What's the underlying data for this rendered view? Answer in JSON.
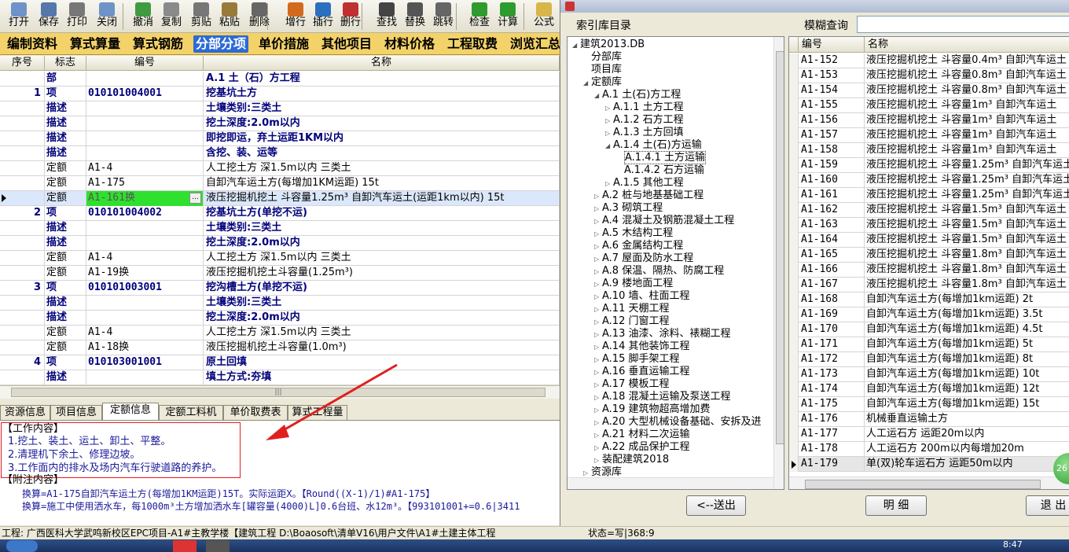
{
  "toolbar": {
    "buttons": [
      {
        "label": "打开",
        "icon": "folder-open-icon"
      },
      {
        "label": "保存",
        "icon": "save-icon"
      },
      {
        "label": "打印",
        "icon": "printer-icon"
      },
      {
        "label": "关闭",
        "icon": "close-folder-icon"
      },
      {
        "label": "撤消",
        "icon": "undo-icon"
      },
      {
        "label": "复制",
        "icon": "copy-icon"
      },
      {
        "label": "剪贴",
        "icon": "scissors-icon"
      },
      {
        "label": "粘贴",
        "icon": "paste-icon"
      },
      {
        "label": "删除",
        "icon": "delete-icon"
      },
      {
        "label": "增行",
        "icon": "add-row-icon"
      },
      {
        "label": "插行",
        "icon": "insert-row-icon"
      },
      {
        "label": "删行",
        "icon": "delete-row-icon"
      },
      {
        "label": "查找",
        "icon": "binoculars-icon"
      },
      {
        "label": "替换",
        "icon": "replace-icon"
      },
      {
        "label": "跳转",
        "icon": "jump-icon"
      },
      {
        "label": "检查",
        "icon": "check-icon"
      },
      {
        "label": "计算",
        "icon": "calculate-icon"
      },
      {
        "label": "公式",
        "icon": "formula-icon"
      }
    ]
  },
  "main_tabs": [
    "编制资料",
    "算式算量",
    "算式钢筋",
    "分部分项",
    "单价措施",
    "其他项目",
    "材料价格",
    "工程取费",
    "浏览汇总"
  ],
  "main_tab_active": "分部分项",
  "grid": {
    "headers": {
      "seq": "序号",
      "flag": "标志",
      "code": "编号",
      "name": "名称"
    },
    "rows": [
      {
        "seq": "",
        "flag": "部",
        "code": "",
        "name": "A.1 土（石）方工程",
        "bold": true
      },
      {
        "seq": "1",
        "flag": "项",
        "code": "010101004001",
        "name": "挖基坑土方",
        "bold": true
      },
      {
        "seq": "",
        "flag": "描述",
        "code": "",
        "name": "土壤类别:三类土",
        "bold": true
      },
      {
        "seq": "",
        "flag": "描述",
        "code": "",
        "name": "挖土深度:2.0m以内",
        "bold": true
      },
      {
        "seq": "",
        "flag": "描述",
        "code": "",
        "name": "即挖即运，弃土运距1KM以内",
        "bold": true
      },
      {
        "seq": "",
        "flag": "描述",
        "code": "",
        "name": "含挖、装、运等",
        "bold": true
      },
      {
        "seq": "",
        "flag": "定额",
        "code": "A1-4",
        "name": "人工挖土方 深1.5m以内 三类土",
        "bold": false
      },
      {
        "seq": "",
        "flag": "定额",
        "code": "A1-175",
        "name": "自卸汽车运土方(每增加1KM运距) 15t",
        "bold": false
      },
      {
        "seq": "",
        "flag": "定额",
        "code": "A1-161换",
        "name": "液压挖掘机挖土 斗容量1.25m³ 自卸汽车运土(运距1km以内) 15t",
        "bold": false,
        "selected": true
      },
      {
        "seq": "2",
        "flag": "项",
        "code": "010101004002",
        "name": "挖基坑土方(单挖不运)",
        "bold": true
      },
      {
        "seq": "",
        "flag": "描述",
        "code": "",
        "name": "土壤类别:三类土",
        "bold": true
      },
      {
        "seq": "",
        "flag": "描述",
        "code": "",
        "name": "挖土深度:2.0m以内",
        "bold": true
      },
      {
        "seq": "",
        "flag": "定额",
        "code": "A1-4",
        "name": "人工挖土方 深1.5m以内 三类土",
        "bold": false
      },
      {
        "seq": "",
        "flag": "定额",
        "code": "A1-19换",
        "name": "液压挖掘机挖土斗容量(1.25m³)",
        "bold": false
      },
      {
        "seq": "3",
        "flag": "项",
        "code": "010101003001",
        "name": "挖沟槽土方(单挖不运)",
        "bold": true
      },
      {
        "seq": "",
        "flag": "描述",
        "code": "",
        "name": "土壤类别:三类土",
        "bold": true
      },
      {
        "seq": "",
        "flag": "描述",
        "code": "",
        "name": "挖土深度:2.0m以内",
        "bold": true
      },
      {
        "seq": "",
        "flag": "定额",
        "code": "A1-4",
        "name": "人工挖土方 深1.5m以内 三类土",
        "bold": false
      },
      {
        "seq": "",
        "flag": "定额",
        "code": "A1-18换",
        "name": "液压挖掘机挖土斗容量(1.0m³)",
        "bold": false
      },
      {
        "seq": "4",
        "flag": "项",
        "code": "010103001001",
        "name": "原土回填",
        "bold": true
      },
      {
        "seq": "",
        "flag": "描述",
        "code": "",
        "name": "填土方式:夯填",
        "bold": true
      }
    ],
    "edit_button": "..."
  },
  "bottom_tabs": [
    "资源信息",
    "项目信息",
    "定额信息",
    "定额工料机",
    "单价取费表",
    "算式工程量"
  ],
  "bottom_tab_active": "定额信息",
  "info": {
    "work_title": "【工作内容】",
    "work_items": [
      "1.挖土、装土、运土、卸土、平整。",
      "2.清理机下余土、修理边坡。",
      "3.工作面内的排水及场内汽车行驶道路的养护。"
    ],
    "note_title": "【附注内容】",
    "note_lines": [
      "换算=A1-175自卸汽车运土方(每增加1KM运距)15T。实际运距X。【Round((X-1)/1)#A1-175】",
      "换算=施工中使用洒水车，每1000m³土方增加洒水车[罐容量(4000)L]0.6台班、水12m³。【993101001+=0.6|3411"
    ]
  },
  "statusbar": {
    "text": "工程: 广西医科大学武鸣新校区EPC项目-A1#主教学楼【建筑工程  D:\\Boaosoft\\清单V16\\用户文件\\A1#土建主体工程",
    "state": "状态=写|368:9"
  },
  "taskbar": {
    "time": "8:47"
  },
  "dialog": {
    "tree_title": "索引库目录",
    "search_label": "模糊查询",
    "search_value": "",
    "tree": [
      {
        "label": "建筑2013.DB",
        "depth": 0,
        "toggle": "◢"
      },
      {
        "label": "分部库",
        "depth": 1,
        "toggle": ""
      },
      {
        "label": "项目库",
        "depth": 1,
        "toggle": ""
      },
      {
        "label": "定额库",
        "depth": 1,
        "toggle": "◢"
      },
      {
        "label": "A.1 土(石)方工程",
        "depth": 2,
        "toggle": "◢"
      },
      {
        "label": "A.1.1 土方工程",
        "depth": 3,
        "toggle": "▷"
      },
      {
        "label": "A.1.2 石方工程",
        "depth": 3,
        "toggle": "▷"
      },
      {
        "label": "A.1.3 土方回填",
        "depth": 3,
        "toggle": "▷"
      },
      {
        "label": "A.1.4 土(石)方运输",
        "depth": 3,
        "toggle": "◢"
      },
      {
        "label": "A.1.4.1 土方运输",
        "depth": 4,
        "toggle": ""
      },
      {
        "label": "A.1.4.2 石方运输",
        "depth": 4,
        "toggle": ""
      },
      {
        "label": "A.1.5 其他工程",
        "depth": 3,
        "toggle": "▷"
      },
      {
        "label": "A.2 桩与地基基础工程",
        "depth": 2,
        "toggle": "▷"
      },
      {
        "label": "A.3 砌筑工程",
        "depth": 2,
        "toggle": "▷"
      },
      {
        "label": "A.4 混凝土及钢筋混凝土工程",
        "depth": 2,
        "toggle": "▷"
      },
      {
        "label": "A.5 木结构工程",
        "depth": 2,
        "toggle": "▷"
      },
      {
        "label": "A.6 金属结构工程",
        "depth": 2,
        "toggle": "▷"
      },
      {
        "label": "A.7 屋面及防水工程",
        "depth": 2,
        "toggle": "▷"
      },
      {
        "label": "A.8 保温、隔热、防腐工程",
        "depth": 2,
        "toggle": "▷"
      },
      {
        "label": "A.9 楼地面工程",
        "depth": 2,
        "toggle": "▷"
      },
      {
        "label": "A.10 墙、柱面工程",
        "depth": 2,
        "toggle": "▷"
      },
      {
        "label": "A.11 天棚工程",
        "depth": 2,
        "toggle": "▷"
      },
      {
        "label": "A.12 门窗工程",
        "depth": 2,
        "toggle": "▷"
      },
      {
        "label": "A.13 油漆、涂料、裱糊工程",
        "depth": 2,
        "toggle": "▷"
      },
      {
        "label": "A.14 其他装饰工程",
        "depth": 2,
        "toggle": "▷"
      },
      {
        "label": "A.15 脚手架工程",
        "depth": 2,
        "toggle": "▷"
      },
      {
        "label": "A.16 垂直运输工程",
        "depth": 2,
        "toggle": "▷"
      },
      {
        "label": "A.17 模板工程",
        "depth": 2,
        "toggle": "▷"
      },
      {
        "label": "A.18 混凝土运输及泵送工程",
        "depth": 2,
        "toggle": "▷"
      },
      {
        "label": "A.19 建筑物超高增加费",
        "depth": 2,
        "toggle": "▷"
      },
      {
        "label": "A.20 大型机械设备基础、安拆及进",
        "depth": 2,
        "toggle": "▷"
      },
      {
        "label": "A.21 材料二次运输",
        "depth": 2,
        "toggle": "▷"
      },
      {
        "label": "A.22 成品保护工程",
        "depth": 2,
        "toggle": "▷"
      },
      {
        "label": "装配建筑2018",
        "depth": 2,
        "toggle": "▷"
      },
      {
        "label": "资源库",
        "depth": 1,
        "toggle": "▷"
      }
    ],
    "list_headers": {
      "code": "编号",
      "name": "名称"
    },
    "list": [
      {
        "code": "A1-152",
        "name": "液压挖掘机挖土 斗容量0.4m³ 自卸汽车运土"
      },
      {
        "code": "A1-153",
        "name": "液压挖掘机挖土 斗容量0.8m³ 自卸汽车运土"
      },
      {
        "code": "A1-154",
        "name": "液压挖掘机挖土 斗容量0.8m³ 自卸汽车运土"
      },
      {
        "code": "A1-155",
        "name": "液压挖掘机挖土 斗容量1m³ 自卸汽车运土"
      },
      {
        "code": "A1-156",
        "name": "液压挖掘机挖土 斗容量1m³ 自卸汽车运土"
      },
      {
        "code": "A1-157",
        "name": "液压挖掘机挖土 斗容量1m³ 自卸汽车运土"
      },
      {
        "code": "A1-158",
        "name": "液压挖掘机挖土 斗容量1m³ 自卸汽车运土"
      },
      {
        "code": "A1-159",
        "name": "液压挖掘机挖土 斗容量1.25m³ 自卸汽车运土"
      },
      {
        "code": "A1-160",
        "name": "液压挖掘机挖土 斗容量1.25m³ 自卸汽车运土"
      },
      {
        "code": "A1-161",
        "name": "液压挖掘机挖土 斗容量1.25m³ 自卸汽车运土"
      },
      {
        "code": "A1-162",
        "name": "液压挖掘机挖土 斗容量1.5m³ 自卸汽车运土"
      },
      {
        "code": "A1-163",
        "name": "液压挖掘机挖土 斗容量1.5m³ 自卸汽车运土"
      },
      {
        "code": "A1-164",
        "name": "液压挖掘机挖土 斗容量1.5m³ 自卸汽车运土"
      },
      {
        "code": "A1-165",
        "name": "液压挖掘机挖土 斗容量1.8m³ 自卸汽车运土"
      },
      {
        "code": "A1-166",
        "name": "液压挖掘机挖土 斗容量1.8m³ 自卸汽车运土"
      },
      {
        "code": "A1-167",
        "name": "液压挖掘机挖土 斗容量1.8m³ 自卸汽车运土"
      },
      {
        "code": "A1-168",
        "name": "自卸汽车运土方(每增加1km运距) 2t"
      },
      {
        "code": "A1-169",
        "name": "自卸汽车运土方(每增加1km运距) 3.5t"
      },
      {
        "code": "A1-170",
        "name": "自卸汽车运土方(每增加1km运距) 4.5t"
      },
      {
        "code": "A1-171",
        "name": "自卸汽车运土方(每增加1km运距) 5t"
      },
      {
        "code": "A1-172",
        "name": "自卸汽车运土方(每增加1km运距) 8t"
      },
      {
        "code": "A1-173",
        "name": "自卸汽车运土方(每增加1km运距) 10t"
      },
      {
        "code": "A1-174",
        "name": "自卸汽车运土方(每增加1km运距) 12t"
      },
      {
        "code": "A1-175",
        "name": "自卸汽车运土方(每增加1km运距) 15t"
      },
      {
        "code": "A1-176",
        "name": "机械垂直运输土方"
      },
      {
        "code": "A1-177",
        "name": "人工运石方 运距20m以内"
      },
      {
        "code": "A1-178",
        "name": "人工运石方 200m以内每增加20m"
      },
      {
        "code": "A1-179",
        "name": "单(双)轮车运石方 运距50m以内"
      }
    ],
    "buttons": {
      "back": "<--送出",
      "detail": "明 细",
      "exit": "退 出"
    },
    "badge": "26"
  },
  "colors": {
    "tab_bar": "#f3d26a",
    "active_tab": "#2d6ad6",
    "edit_cell": "#2fe02f",
    "annotation": "#e02020",
    "bold_text": "#00007a"
  }
}
